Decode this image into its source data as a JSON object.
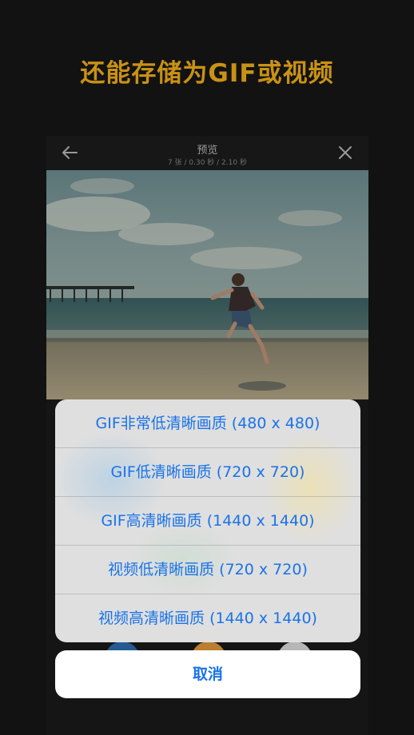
{
  "headline": "还能存储为GIF或视频",
  "preview": {
    "title": "预览",
    "subtitle": "7 张 / 0.30 秒 / 2.10 秒",
    "back_icon": "arrow-left-icon",
    "close_icon": "close-icon"
  },
  "action_sheet": {
    "options": [
      "GIF非常低清晰画质 (480 x 480)",
      "GIF低清晰画质 (720 x 720)",
      "GIF高清晰画质 (1440 x 1440)",
      "视频低清晰画质 (720 x 720)",
      "视频高清晰画质 (1440 x 1440)"
    ],
    "cancel_label": "取消"
  },
  "colors": {
    "headline": "#f6b219",
    "accent": "#1a73e8",
    "background": "#161616"
  }
}
